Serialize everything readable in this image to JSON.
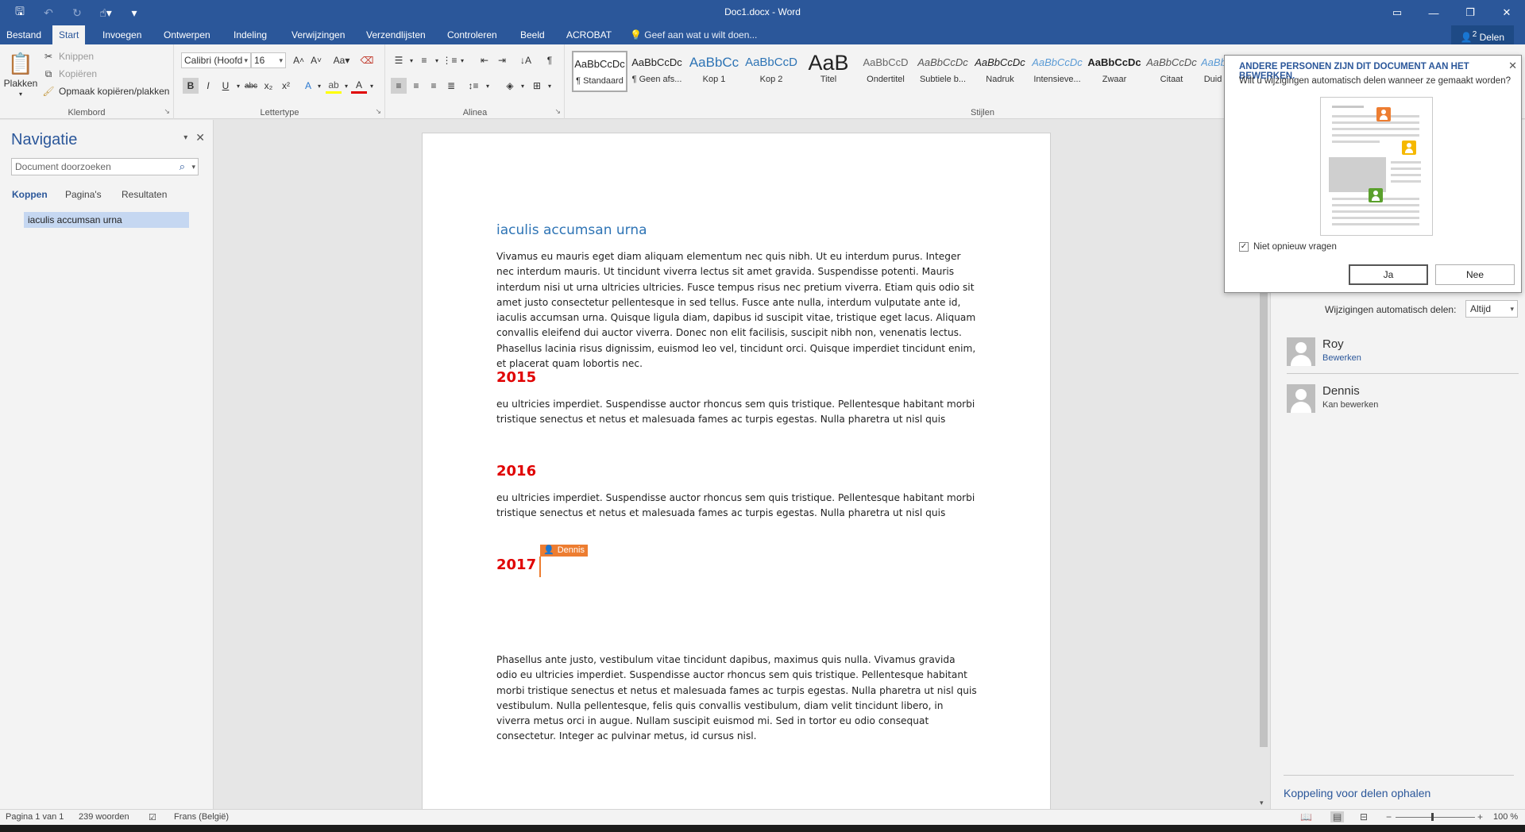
{
  "titlebar": {
    "doc_title": "Doc1.docx - Word",
    "qat_icons": [
      "save-icon",
      "undo-icon",
      "redo-icon",
      "touch-mode-icon",
      "customize-qat-icon"
    ],
    "window_controls": [
      "ribbon-display-icon",
      "minimize-icon",
      "restore-icon",
      "close-icon"
    ]
  },
  "tabs": {
    "items": [
      "Bestand",
      "Start",
      "Invoegen",
      "Ontwerpen",
      "Indeling",
      "Verwijzingen",
      "Verzendlijsten",
      "Controleren",
      "Beeld",
      "ACROBAT"
    ],
    "active": "Start",
    "tell_me": "Geef aan wat u wilt doen...",
    "share_label": "Delen",
    "share_count": "2"
  },
  "ribbon": {
    "clipboard": {
      "paste": "Plakken",
      "cut": "Knippen",
      "copy": "Kopiëren",
      "format_painter": "Opmaak kopiëren/plakken",
      "label": "Klembord"
    },
    "font": {
      "family": "Calibri (Hoofd",
      "size": "16",
      "label": "Lettertype"
    },
    "paragraph": {
      "label": "Alinea"
    },
    "styles": {
      "label": "Stijlen",
      "tiles": [
        {
          "preview": "AaBbCcDc",
          "name": "¶ Standaard"
        },
        {
          "preview": "AaBbCcDc",
          "name": "¶ Geen afs..."
        },
        {
          "preview": "AaBbCc",
          "name": "Kop 1"
        },
        {
          "preview": "AaBbCcD",
          "name": "Kop 2"
        },
        {
          "preview": "AaB",
          "name": "Titel"
        },
        {
          "preview": "AaBbCcD",
          "name": "Ondertitel"
        },
        {
          "preview": "AaBbCcDc",
          "name": "Subtiele b..."
        },
        {
          "preview": "AaBbCcDc",
          "name": "Nadruk"
        },
        {
          "preview": "AaBbCcDc",
          "name": "Intensieve..."
        },
        {
          "preview": "AaBbCcDc",
          "name": "Zwaar"
        },
        {
          "preview": "AaBbCcDc",
          "name": "Citaat"
        },
        {
          "preview": "AaBb",
          "name": "Duid"
        }
      ]
    }
  },
  "navigation": {
    "title": "Navigatie",
    "search_placeholder": "Document doorzoeken",
    "tabs": [
      "Koppen",
      "Pagina's",
      "Resultaten"
    ],
    "active_tab": "Koppen",
    "headings": [
      "iaculis accumsan urna"
    ]
  },
  "document": {
    "heading": "iaculis accumsan urna",
    "intro": "Vivamus eu mauris eget diam aliquam elementum nec quis nibh. Ut eu interdum purus. Integer nec interdum mauris. Ut tincidunt viverra lectus sit amet gravida. Suspendisse potenti. Mauris interdum nisi ut urna ultricies ultricies. Fusce tempus risus nec pretium viverra. Etiam quis odio sit amet justo consectetur pellentesque in sed tellus. Fusce ante nulla, interdum vulputate ante id, iaculis accumsan urna. Quisque ligula diam, dapibus id suscipit vitae, tristique eget lacus. Aliquam convallis eleifend dui auctor viverra. Donec non elit facilisis, suscipit nibh non, venenatis lectus. Phasellus lacinia risus dignissim, euismod leo vel, tincidunt orci. Quisque imperdiet tincidunt enim, et placerat quam lobortis nec.",
    "sections": [
      {
        "year": "2015",
        "text": "eu ultricies imperdiet. Suspendisse auctor rhoncus sem quis tristique. Pellentesque habitant morbi tristique senectus et netus et malesuada fames ac turpis egestas. Nulla pharetra ut nisl quis"
      },
      {
        "year": "2016",
        "text": "eu ultricies imperdiet. Suspendisse auctor rhoncus sem quis tristique. Pellentesque habitant morbi tristique senectus et netus et malesuada fames ac turpis egestas. Nulla pharetra ut nisl quis"
      },
      {
        "year": "2017",
        "text": "Phasellus ante justo, vestibulum vitae tincidunt dapibus, maximus quis nulla. Vivamus gravida odio eu ultricies imperdiet. Suspendisse auctor rhoncus sem quis tristique. Pellentesque habitant morbi tristique senectus et netus et malesuada fames ac turpis egestas. Nulla pharetra ut nisl quis vestibulum. Nulla pellentesque, felis quis convallis vestibulum, diam velit tincidunt libero, in viverra metus orci in augue. Nullam suscipit euismod mi. Sed in tortor eu odio consequat consectetur. Integer ac pulvinar metus, id cursus nisl."
      }
    ],
    "coauthor_flag": "Dennis",
    "heading_color": "#2e74b5",
    "year_color": "#e00000",
    "coauthor_color": "#ed7d31"
  },
  "popup": {
    "title": "ANDERE PERSONEN ZIJN DIT DOCUMENT AAN HET BEWERKEN.",
    "message": "Wilt u wijzigingen automatisch delen wanneer ze gemaakt worden?",
    "checkbox_label": "Niet opnieuw vragen",
    "checkbox_checked": true,
    "yes_label": "Ja",
    "no_label": "Nee"
  },
  "sharepane": {
    "autoshare_label": "Wijzigingen automatisch delen:",
    "autoshare_value": "Altijd",
    "people": [
      {
        "name": "Roy",
        "status": "Bewerken"
      },
      {
        "name": "Dennis",
        "status": "Kan bewerken"
      }
    ],
    "get_link": "Koppeling voor delen ophalen"
  },
  "statusbar": {
    "page": "Pagina 1 van 1",
    "words": "239 woorden",
    "language": "Frans (België)",
    "zoom": "100 %"
  },
  "colors": {
    "brand": "#2b579a",
    "accent_orange": "#ed7d31"
  }
}
